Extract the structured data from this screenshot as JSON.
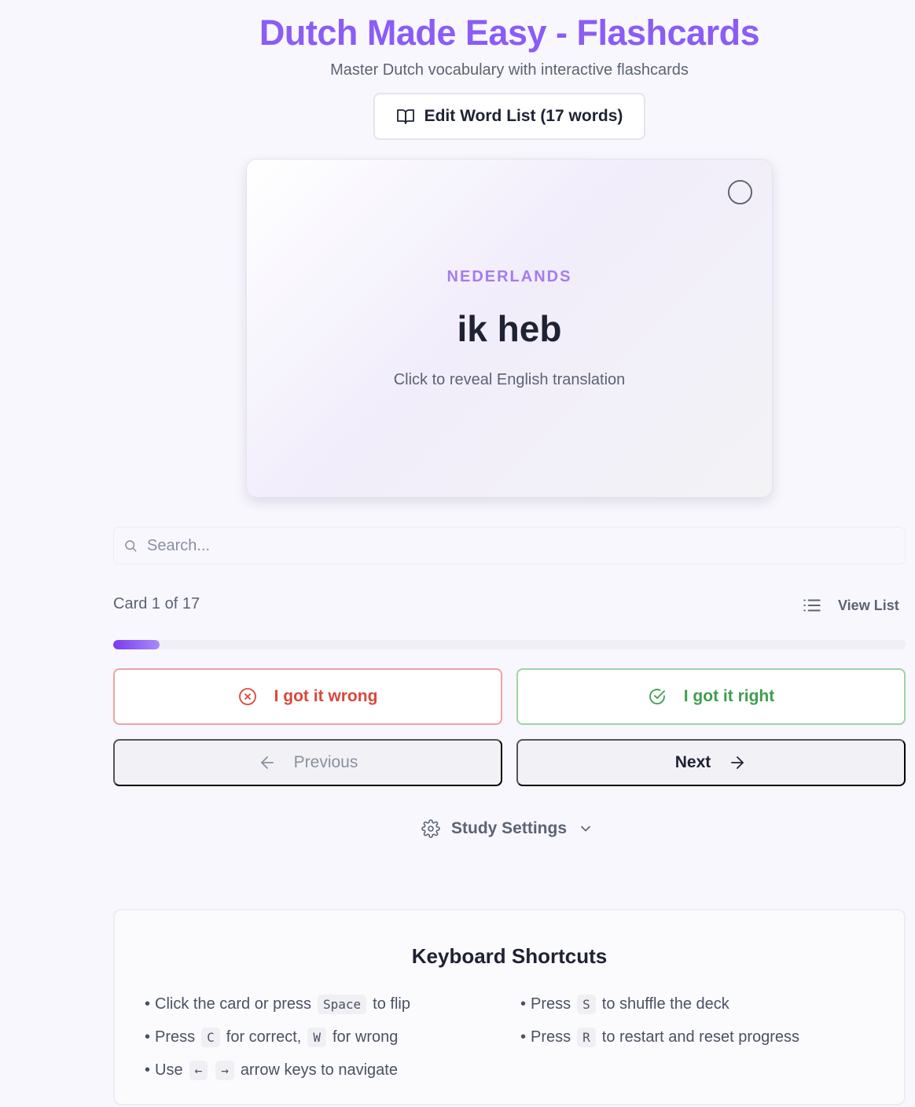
{
  "header": {
    "title": "Dutch Made Easy - Flashcards",
    "subtitle": "Master Dutch vocabulary with interactive flashcards",
    "edit_button_label": "Edit Word List (17 words)"
  },
  "card": {
    "language_label": "NEDERLANDS",
    "word": "ik heb",
    "hint": "Click to reveal English translation"
  },
  "search": {
    "placeholder": "Search..."
  },
  "progress": {
    "card_count_text": "Card 1 of 17",
    "view_list_label": "View List",
    "fraction": 0.0588
  },
  "actions": {
    "wrong_label": "I got it wrong",
    "right_label": "I got it right",
    "previous_label": "Previous",
    "next_label": "Next"
  },
  "settings": {
    "label": "Study Settings"
  },
  "shortcuts": {
    "title": "Keyboard Shortcuts",
    "items": {
      "flip_pre": "Click the card or press",
      "flip_key": "Space",
      "flip_post": "to flip",
      "mark_pre": "Press",
      "mark_key_correct": "C",
      "mark_mid": "for correct,",
      "mark_key_wrong": "W",
      "mark_post": "for wrong",
      "nav_pre": "Use",
      "nav_key_left": "←",
      "nav_key_right": "→",
      "nav_post": "arrow keys to navigate",
      "shuffle_pre": "Press",
      "shuffle_key": "S",
      "shuffle_post": "to shuffle the deck",
      "restart_pre": "Press",
      "restart_key": "R",
      "restart_post": "to restart and reset progress",
      "bullet": "•"
    }
  },
  "colors": {
    "accent": "#8b5cf6",
    "wrong": "#d9483b",
    "right": "#3f9d4f",
    "background": "#f8f7fd"
  },
  "icons": {
    "edit_button": "book-open-icon",
    "card_status": "circle-icon",
    "search": "search-icon",
    "view_list": "list-icon",
    "wrong": "x-circle-icon",
    "right": "check-circle-icon",
    "previous": "arrow-left-icon",
    "next": "arrow-right-icon",
    "settings": "gear-icon",
    "settings_toggle": "chevron-down-icon"
  }
}
